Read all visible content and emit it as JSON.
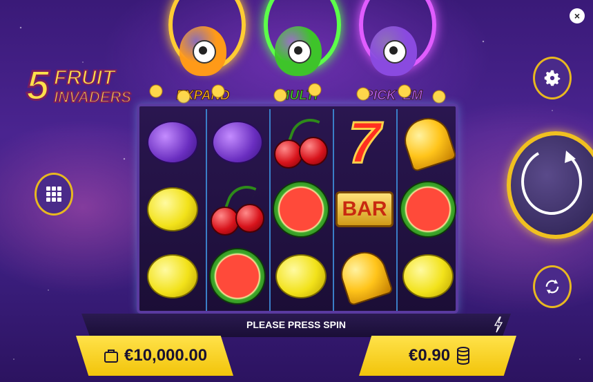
{
  "game": {
    "logo": {
      "number": "5",
      "line1": "FRUIT",
      "line2": "INVADERS"
    },
    "features": [
      {
        "label": "EXPAND",
        "color": "#ffb21a",
        "body_color": "#ff9a18",
        "portal_color": "#ffcc33"
      },
      {
        "label": "MULTI",
        "color": "#38d82a",
        "body_color": "#3ec42a",
        "portal_color": "#5cff4a"
      },
      {
        "label": "PICK 'EM",
        "color": "#b45cff",
        "body_color": "#8a4ae0",
        "portal_color": "#e05cff"
      }
    ],
    "reels": [
      [
        "plum",
        "lemon",
        "lemon"
      ],
      [
        "plum",
        "cherry",
        "watermelon"
      ],
      [
        "cherry",
        "watermelon",
        "lemon"
      ],
      [
        "seven",
        "bar",
        "bell"
      ],
      [
        "bell",
        "watermelon",
        "lemon"
      ]
    ],
    "symbol_text": {
      "seven": "7",
      "bar": "BAR"
    },
    "message": "PLEASE PRESS SPIN",
    "balance": "€10,000.00",
    "bet": "€0.90",
    "close_label": "×",
    "icons": {
      "menu": "grid-icon",
      "settings": "gear-icon",
      "spin": "spin-arrow-icon",
      "autoplay": "autoplay-icon",
      "turbo": "lightning-icon",
      "wallet": "wallet-icon",
      "coins": "coin-stack-icon"
    },
    "accent_color": "#f2c40a"
  }
}
